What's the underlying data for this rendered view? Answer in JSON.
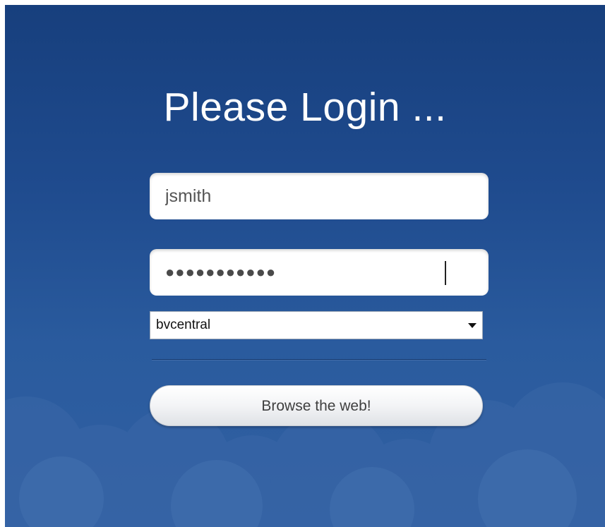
{
  "login": {
    "title": "Please Login ...",
    "username_value": "jsmith",
    "password_value": "●●●●●●●●●●●",
    "domain_selected": "bvcentral",
    "submit_label": "Browse the web!"
  },
  "colors": {
    "background_top": "#173f7d",
    "background_bottom": "#3160a2",
    "cloud": "#3a67a8",
    "field_background": "#ffffff",
    "button_background": "#f3f4f6"
  },
  "icons": {
    "select_arrow": "chevron-down-icon"
  }
}
